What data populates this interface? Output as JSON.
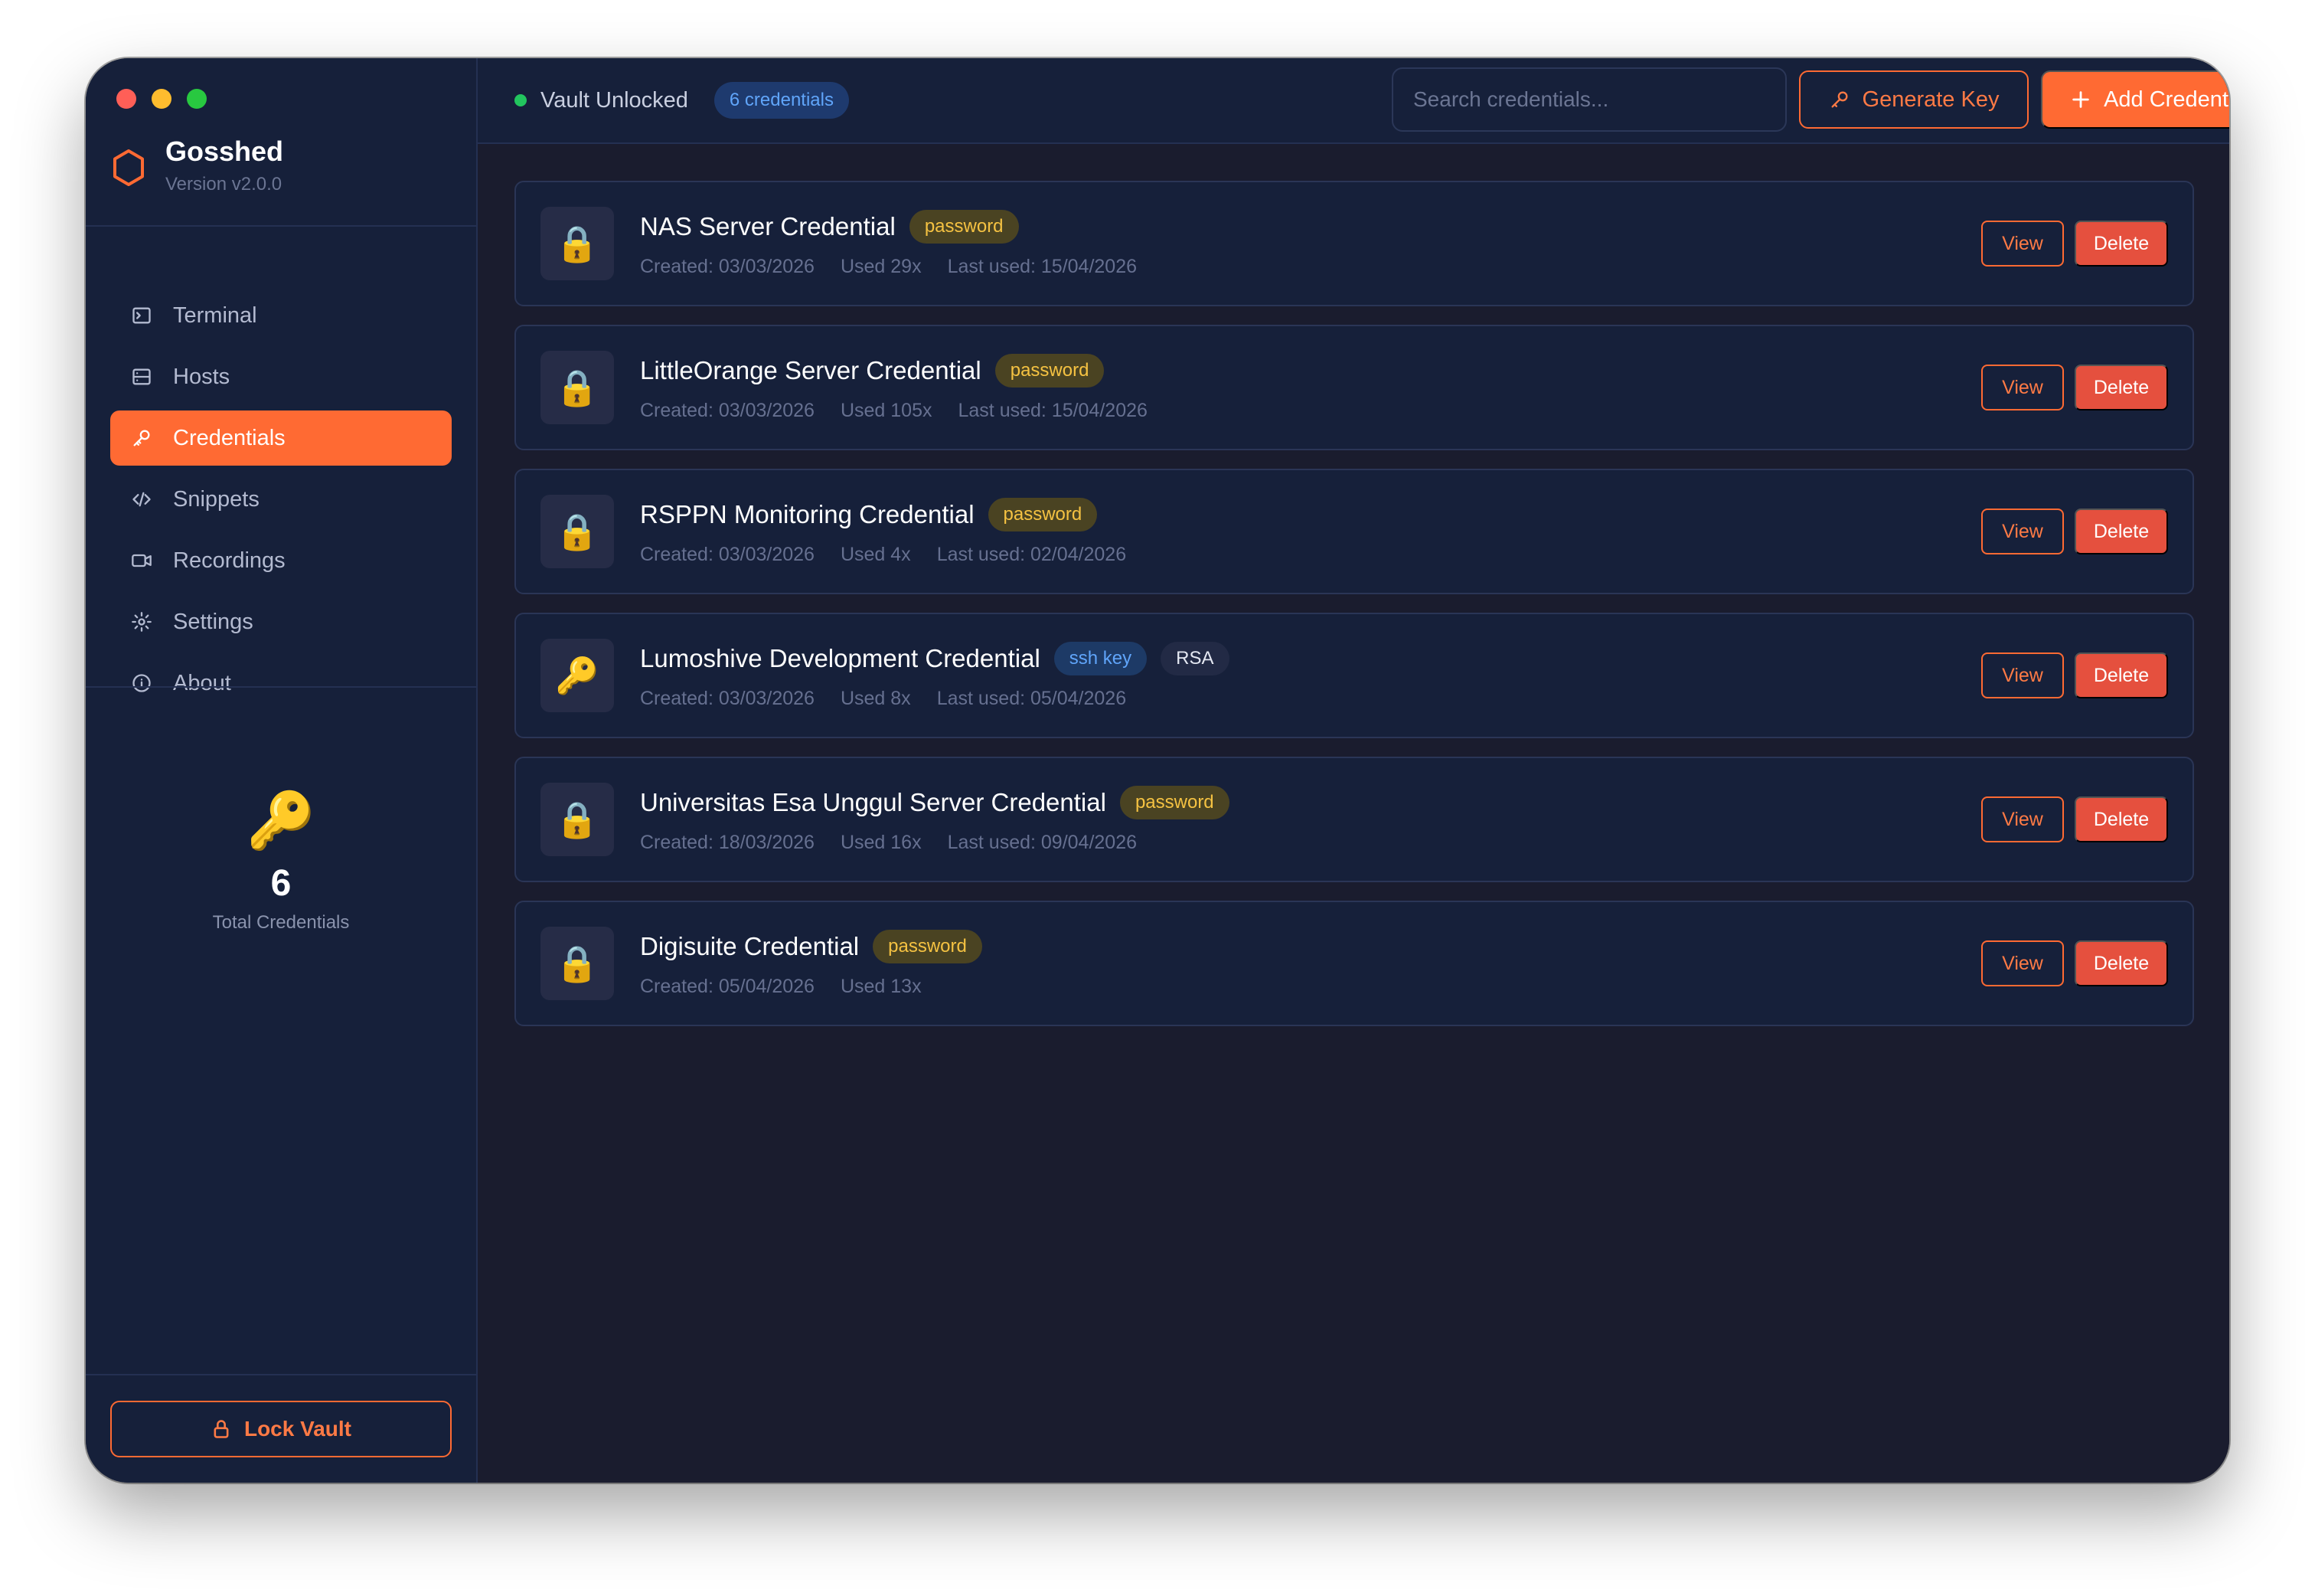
{
  "app": {
    "name": "Gosshed",
    "version": "Version v2.0.0"
  },
  "colors": {
    "accent": "#ff6a33",
    "danger": "#e5503e",
    "status_ok": "#22c55e",
    "close": "#ff5f57",
    "minimize": "#febc2e",
    "maximize": "#28c840"
  },
  "sidebar": {
    "nav": [
      {
        "label": "Terminal",
        "icon": "terminal-icon",
        "active": false
      },
      {
        "label": "Hosts",
        "icon": "server-icon",
        "active": false
      },
      {
        "label": "Credentials",
        "icon": "key-icon",
        "active": true
      },
      {
        "label": "Snippets",
        "icon": "code-icon",
        "active": false
      },
      {
        "label": "Recordings",
        "icon": "video-icon",
        "active": false
      },
      {
        "label": "Settings",
        "icon": "gear-icon",
        "active": false
      },
      {
        "label": "About",
        "icon": "info-icon",
        "active": false
      }
    ],
    "stats": {
      "icon": "🔑",
      "count": "6",
      "label": "Total Credentials"
    },
    "lock_label": "Lock Vault"
  },
  "topbar": {
    "status": "Vault Unlocked",
    "count_badge": "6 credentials",
    "search_placeholder": "Search credentials...",
    "generate_label": "Generate Key",
    "add_label": "Add Credential"
  },
  "actions": {
    "view": "View",
    "delete": "Delete"
  },
  "credentials": [
    {
      "icon": "🔒",
      "name": "NAS Server Credential",
      "type": "password",
      "algo": "",
      "created": "Created: 03/03/2026",
      "used": "Used 29x",
      "last_used": "Last used: 15/04/2026"
    },
    {
      "icon": "🔒",
      "name": "LittleOrange Server Credential",
      "type": "password",
      "algo": "",
      "created": "Created: 03/03/2026",
      "used": "Used 105x",
      "last_used": "Last used: 15/04/2026"
    },
    {
      "icon": "🔒",
      "name": "RSPPN Monitoring Credential",
      "type": "password",
      "algo": "",
      "created": "Created: 03/03/2026",
      "used": "Used 4x",
      "last_used": "Last used: 02/04/2026"
    },
    {
      "icon": "🔑",
      "name": "Lumoshive Development Credential",
      "type": "ssh key",
      "algo": "RSA",
      "created": "Created: 03/03/2026",
      "used": "Used 8x",
      "last_used": "Last used: 05/04/2026"
    },
    {
      "icon": "🔒",
      "name": "Universitas Esa Unggul Server Credential",
      "type": "password",
      "algo": "",
      "created": "Created: 18/03/2026",
      "used": "Used 16x",
      "last_used": "Last used: 09/04/2026"
    },
    {
      "icon": "🔒",
      "name": "Digisuite Credential",
      "type": "password",
      "algo": "",
      "created": "Created: 05/04/2026",
      "used": "Used 13x",
      "last_used": ""
    }
  ]
}
